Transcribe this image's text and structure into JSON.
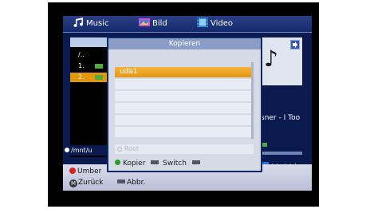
{
  "tabs": [
    {
      "label": "Music",
      "icon": "music-note-icon"
    },
    {
      "label": "Bild",
      "icon": "picture-icon"
    },
    {
      "label": "Video",
      "icon": "film-icon"
    }
  ],
  "file_list": {
    "items": [
      "/..",
      "1.",
      "2."
    ],
    "selected_index": 2
  },
  "path": "/mnt/u",
  "now_playing": {
    "artist_fragment": "sner - I Too"
  },
  "bottom_hints": {
    "red_label": "Umber",
    "m_label": "Zurück",
    "cancel_label": "Abbr."
  },
  "dialog": {
    "title": "Kopieren",
    "selected_item": "uda1",
    "root_label": "Root",
    "copy_label": "Kopier",
    "switch_label": "Switch"
  },
  "colors": {
    "background": "#0a1a4e",
    "highlight": "#e79710",
    "dialog_bg": "#d5dae6",
    "green_button": "#2a9e2a",
    "red_button": "#d92222"
  }
}
